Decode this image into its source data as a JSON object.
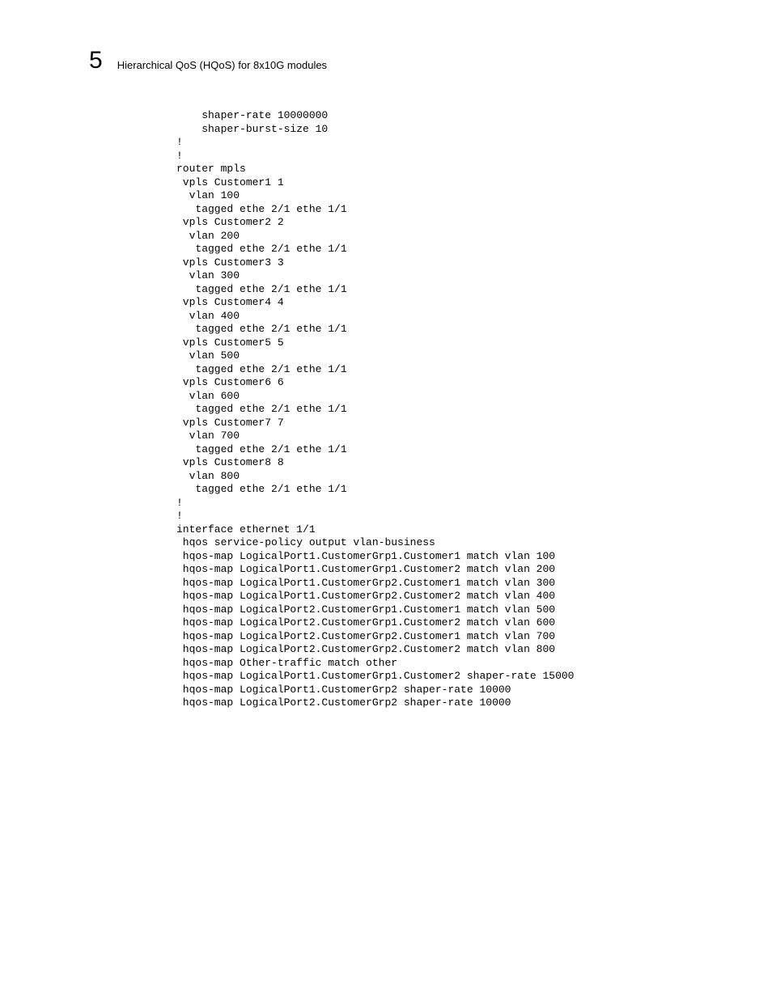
{
  "header": {
    "chapter_number": "5",
    "title": "Hierarchical QoS (HQoS) for 8x10G modules"
  },
  "config": {
    "text": "    shaper-rate 10000000\n    shaper-burst-size 10\n!\n!\nrouter mpls\n vpls Customer1 1\n  vlan 100\n   tagged ethe 2/1 ethe 1/1\n vpls Customer2 2\n  vlan 200\n   tagged ethe 2/1 ethe 1/1\n vpls Customer3 3\n  vlan 300\n   tagged ethe 2/1 ethe 1/1\n vpls Customer4 4\n  vlan 400\n   tagged ethe 2/1 ethe 1/1\n vpls Customer5 5\n  vlan 500\n   tagged ethe 2/1 ethe 1/1\n vpls Customer6 6\n  vlan 600\n   tagged ethe 2/1 ethe 1/1\n vpls Customer7 7\n  vlan 700\n   tagged ethe 2/1 ethe 1/1\n vpls Customer8 8\n  vlan 800\n   tagged ethe 2/1 ethe 1/1\n!\n!\ninterface ethernet 1/1\n hqos service-policy output vlan-business\n hqos-map LogicalPort1.CustomerGrp1.Customer1 match vlan 100\n hqos-map LogicalPort1.CustomerGrp1.Customer2 match vlan 200\n hqos-map LogicalPort1.CustomerGrp2.Customer1 match vlan 300\n hqos-map LogicalPort1.CustomerGrp2.Customer2 match vlan 400\n hqos-map LogicalPort2.CustomerGrp1.Customer1 match vlan 500\n hqos-map LogicalPort2.CustomerGrp1.Customer2 match vlan 600\n hqos-map LogicalPort2.CustomerGrp2.Customer1 match vlan 700\n hqos-map LogicalPort2.CustomerGrp2.Customer2 match vlan 800\n hqos-map Other-traffic match other\n hqos-map LogicalPort1.CustomerGrp1.Customer2 shaper-rate 15000\n hqos-map LogicalPort1.CustomerGrp2 shaper-rate 10000\n hqos-map LogicalPort2.CustomerGrp2 shaper-rate 10000"
  }
}
